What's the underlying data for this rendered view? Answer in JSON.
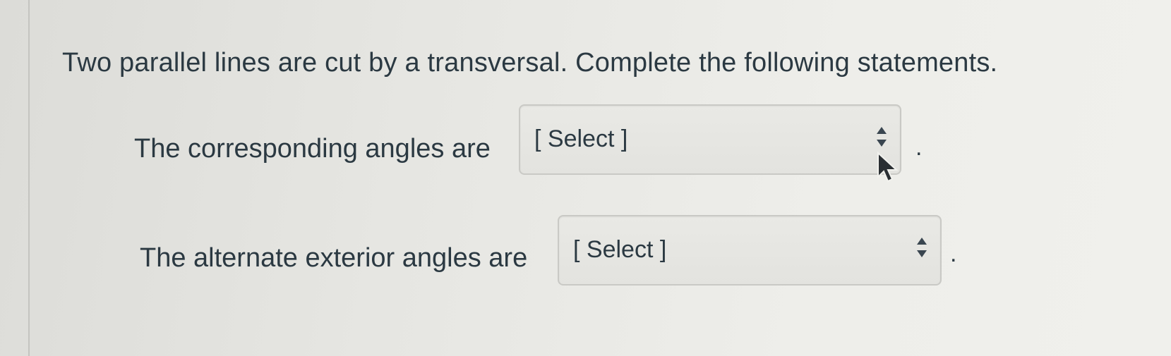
{
  "question": {
    "prompt": "Two parallel lines are cut by a transversal. Complete the following statements."
  },
  "statements": [
    {
      "label": "The corresponding angles are",
      "select_value": "[ Select ]",
      "suffix": "."
    },
    {
      "label": "The alternate exterior angles are",
      "select_value": "[ Select ]",
      "suffix": "."
    }
  ],
  "icons": {
    "select_arrows": "up-down-arrows-icon",
    "cursor": "mouse-pointer-icon"
  },
  "colors": {
    "text": "#2b3942",
    "select_bg": "#e6e6e2",
    "select_border": "#c9c9c5"
  }
}
